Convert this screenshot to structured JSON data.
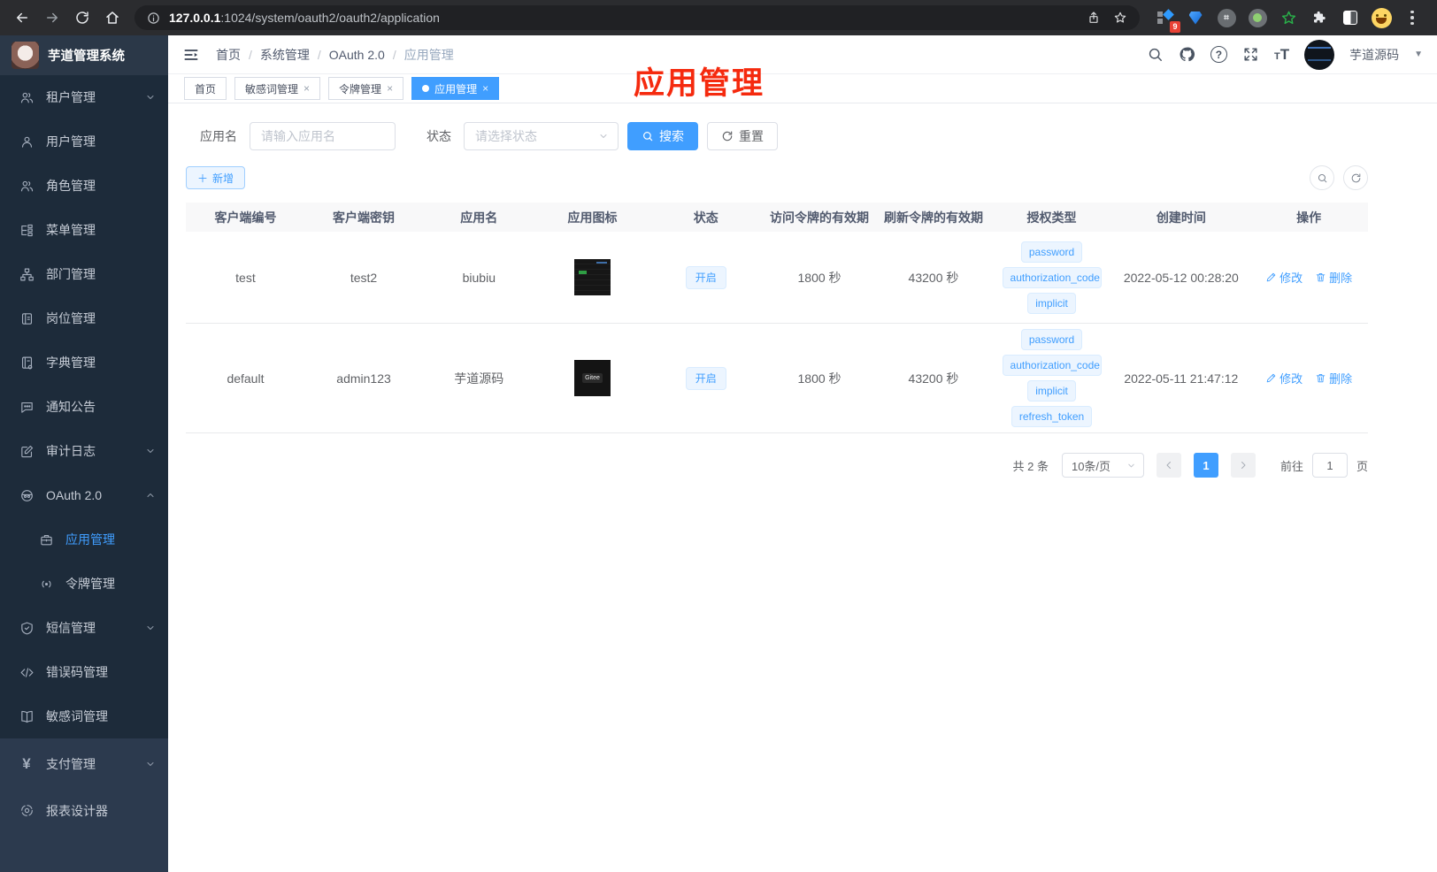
{
  "theme": {
    "accent": "#409eff",
    "annotation_red": "#f52a0e",
    "sidebar_bg": "#1d2b3a",
    "tag_bg": "#ecf5ff"
  },
  "browser": {
    "url_host": "127.0.0.1",
    "url_rest": ":1024/system/oauth2/oauth2/application",
    "extension_badge": "9"
  },
  "sidebar": {
    "logo_title": "芋道管理系统",
    "menu": {
      "tenant": "租户管理",
      "user": "用户管理",
      "role": "角色管理",
      "menu": "菜单管理",
      "dept": "部门管理",
      "post": "岗位管理",
      "dict": "字典管理",
      "notice": "通知公告",
      "audit": "审计日志",
      "oauth": "OAuth 2.0",
      "oauth_app": "应用管理",
      "oauth_token": "令牌管理",
      "sms": "短信管理",
      "errcode": "错误码管理",
      "sensitive": "敏感词管理",
      "pay": "支付管理",
      "report": "报表设计器"
    }
  },
  "navbar": {
    "breadcrumbs": [
      "首页",
      "系统管理",
      "OAuth 2.0",
      "应用管理"
    ],
    "user_name": "芋道源码"
  },
  "tabs": [
    {
      "label": "首页"
    },
    {
      "label": "敏感词管理",
      "close": "×"
    },
    {
      "label": "令牌管理",
      "close": "×"
    },
    {
      "label": "应用管理",
      "close": "×"
    }
  ],
  "annotation": {
    "text": "应用管理"
  },
  "filters": {
    "name_label": "应用名",
    "name_placeholder": "请输入应用名",
    "status_label": "状态",
    "status_placeholder": "请选择状态",
    "search_label": "搜索",
    "reset_label": "重置"
  },
  "toolbar": {
    "add_label": "新增"
  },
  "table": {
    "columns": [
      "客户端编号",
      "客户端密钥",
      "应用名",
      "应用图标",
      "状态",
      "访问令牌的有效期",
      "刷新令牌的有效期",
      "授权类型",
      "创建时间",
      "操作"
    ],
    "edit_label": "修改",
    "delete_label": "删除",
    "rows": [
      {
        "client_id": "test",
        "secret": "test2",
        "name": "biubiu",
        "status": "开启",
        "access_ttl": "1800 秒",
        "refresh_ttl": "43200 秒",
        "grants": [
          "password",
          "authorization_code",
          "implicit"
        ],
        "created": "2022-05-12 00:28:20"
      },
      {
        "client_id": "default",
        "secret": "admin123",
        "name": "芋道源码",
        "status": "开启",
        "icon_text": "Gitee",
        "access_ttl": "1800 秒",
        "refresh_ttl": "43200 秒",
        "grants": [
          "password",
          "authorization_code",
          "implicit",
          "refresh_token"
        ],
        "created": "2022-05-11 21:47:12"
      }
    ]
  },
  "pagination": {
    "total": "共 2 条",
    "page_size": "10条/页",
    "current_page": "1",
    "goto_label": "前往",
    "goto_value": "1",
    "page_label": "页"
  }
}
